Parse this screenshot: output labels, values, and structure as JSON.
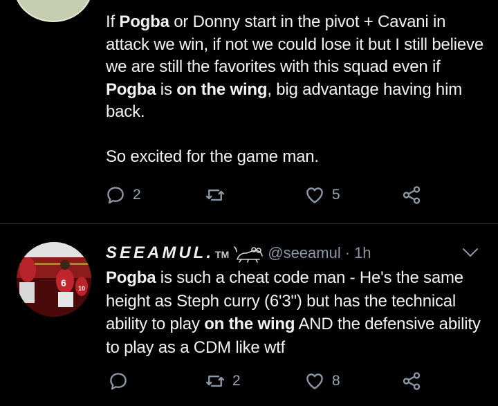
{
  "tweet1": {
    "segments": [
      {
        "text": "If ",
        "bold": false
      },
      {
        "text": "Pogba",
        "bold": true
      },
      {
        "text": " or Donny start in the pivot + Cavani in attack we win, if not we could lose it but I still believe we are still the favorites with this squad even if ",
        "bold": false
      },
      {
        "text": "Pogba",
        "bold": true
      },
      {
        "text": " is ",
        "bold": false
      },
      {
        "text": "on the wing",
        "bold": true
      },
      {
        "text": ", big advantage having him back.",
        "bold": false
      }
    ],
    "paragraph2": "So excited for the game man.",
    "reply_count": "2",
    "retweet_count": "",
    "like_count": "5"
  },
  "tweet2": {
    "display_name": "SEEAMUL.",
    "tm": "TM",
    "handle": "@seeamul",
    "separator": "·",
    "time": "1h",
    "segments": [
      {
        "text": "Pogba",
        "bold": true
      },
      {
        "text": " is such a cheat code man - He's the same height as Steph curry (6'3\") but has the technical ability to play ",
        "bold": false
      },
      {
        "text": "on the wing",
        "bold": true
      },
      {
        "text": " AND the defensive ability to play as a CDM like wtf",
        "bold": false
      }
    ],
    "reply_count": "",
    "retweet_count": "2",
    "like_count": "8"
  },
  "icons": {
    "reply": "reply-icon",
    "retweet": "retweet-icon",
    "like": "heart-icon",
    "share": "share-icon",
    "more": "chevron-down-icon",
    "emoji": "frog-emoji-icon"
  },
  "colors": {
    "background": "#000000",
    "text": "#f0f2f3",
    "secondary": "#8b98a5",
    "divider": "#2f3336"
  }
}
